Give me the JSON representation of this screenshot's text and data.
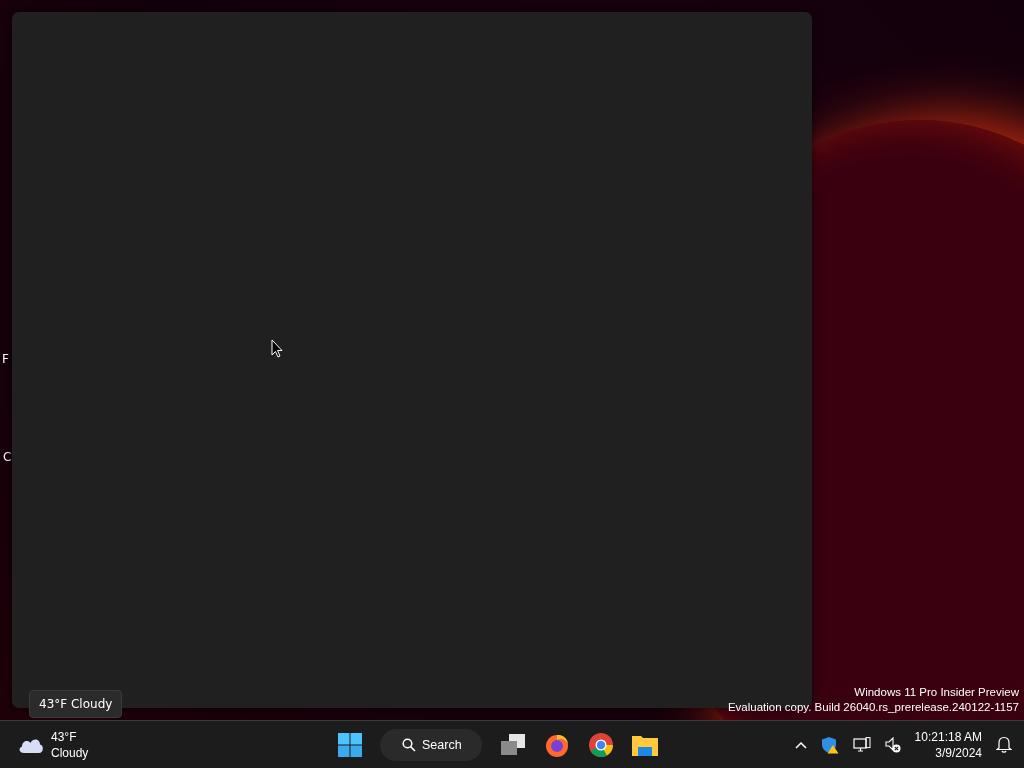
{
  "desktop": {
    "icon_labels": [
      "F",
      "C"
    ],
    "tooltip": "43°F Cloudy",
    "watermark": [
      "Windows 11 Pro Insider Preview",
      "Evaluation copy. Build 26040.rs_prerelease.240122-1157"
    ]
  },
  "taskbar": {
    "weather": {
      "temperature": "43°F",
      "condition": "Cloudy"
    },
    "search": {
      "label": "Search"
    },
    "clock": {
      "time": "10:21:18 AM",
      "date": "3/9/2024"
    }
  }
}
